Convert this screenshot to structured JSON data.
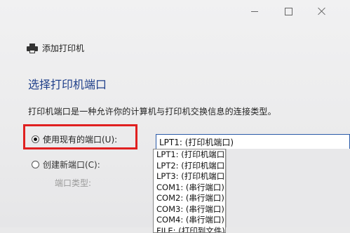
{
  "header": {
    "title": "添加打印机"
  },
  "section": {
    "title": "选择打印机端口"
  },
  "description": "打印机端口是一种允许你的计算机与打印机交换信息的连接类型。",
  "options": {
    "existing": "使用现有的端口(U):",
    "new": "创建新端口(C):",
    "port_type_label": "端口类型:"
  },
  "port_select": {
    "selected": "LPT1: (打印机端口)",
    "items": [
      "LPT1: (打印机端口)",
      "LPT2: (打印机端口)",
      "LPT3: (打印机端口)",
      "COM1: (串行端口)",
      "COM2: (串行端口)",
      "COM3: (串行端口)",
      "COM4: (串行端口)",
      "FILE: (打印到文件)"
    ]
  },
  "colors": {
    "highlight": "#e02020",
    "section_title": "#1f3f8a"
  }
}
